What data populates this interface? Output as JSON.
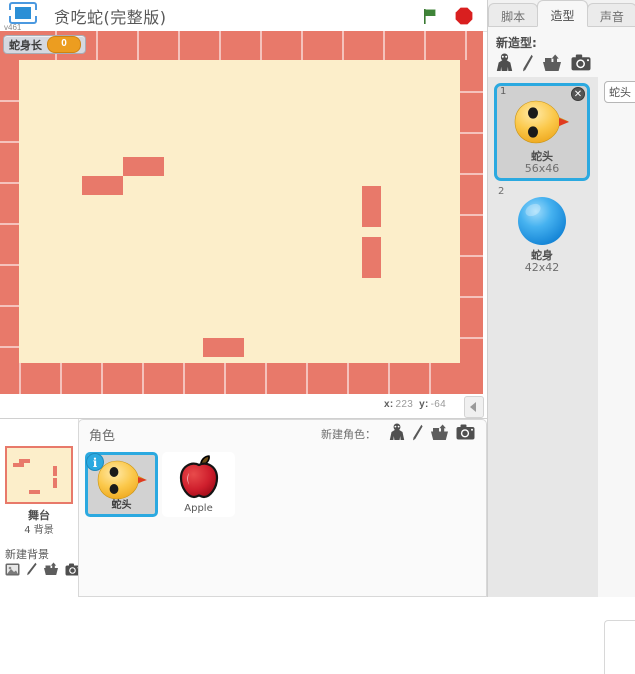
{
  "app": {
    "version_label": "v461",
    "project_title": "贪吃蛇(完整版)",
    "logo_icon": "scratch-logo-icon",
    "green_flag_icon": "green-flag-icon",
    "stop_icon": "stop-sign-icon"
  },
  "stage": {
    "variable_watcher": {
      "label": "蛇身长",
      "value": "0"
    },
    "colors": {
      "background": "#fceeca",
      "wall": "#e8796a"
    },
    "mouse_coords": {
      "x_label": "x:",
      "x_value": "223",
      "y_label": "y:",
      "y_value": "-64"
    },
    "collapse_icon": "collapse-left-arrow-icon"
  },
  "sprite_pane": {
    "header_title": "角色",
    "new_sprite_label": "新建角色：",
    "new_sprite_icons": [
      "choose-sprite-icon",
      "paint-sprite-icon",
      "upload-sprite-icon",
      "camera-sprite-icon"
    ],
    "stage_thumb": {
      "name": "舞台",
      "subtitle": "4 背景",
      "new_backdrop_label": "新建背景",
      "new_backdrop_icons": [
        "choose-backdrop-icon",
        "paint-backdrop-icon",
        "upload-backdrop-icon",
        "camera-backdrop-icon"
      ]
    },
    "sprites": [
      {
        "name": "蛇头",
        "selected": true,
        "badge": "i",
        "thumb": "snake-head-icon"
      },
      {
        "name": "Apple",
        "selected": false,
        "badge": "",
        "thumb": "apple-icon"
      }
    ]
  },
  "right_panel": {
    "tabs": [
      {
        "label": "脚本",
        "active": false
      },
      {
        "label": "造型",
        "active": true
      },
      {
        "label": "声音",
        "active": false
      }
    ],
    "new_costume_label": "新造型:",
    "new_costume_icons": [
      "choose-costume-icon",
      "paint-costume-icon",
      "upload-costume-icon",
      "camera-costume-icon"
    ],
    "costumes": [
      {
        "index": "1",
        "name": "蛇头",
        "size": "56x46",
        "selected": true,
        "thumb": "snake-head-icon",
        "delete_icon": "close-icon"
      },
      {
        "index": "2",
        "name": "蛇身",
        "size": "42x42",
        "selected": false,
        "thumb": "snake-body-icon",
        "delete_icon": ""
      }
    ],
    "costume_name_input": {
      "value": "蛇头",
      "placeholder": ""
    }
  }
}
